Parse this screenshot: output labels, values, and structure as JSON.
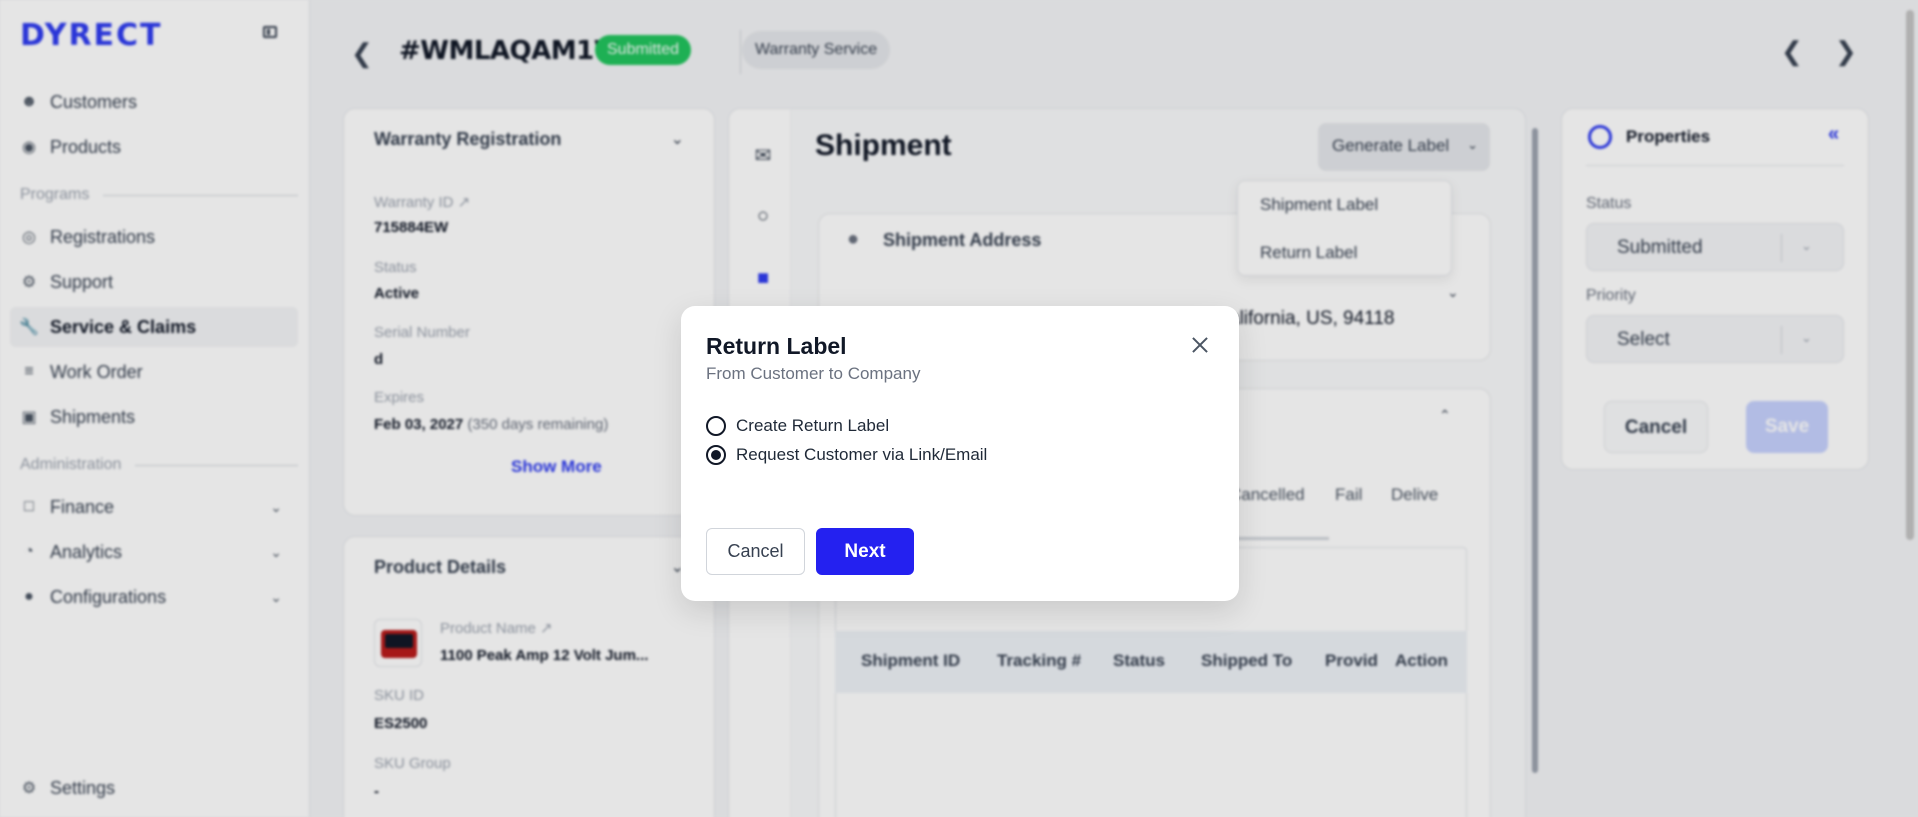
{
  "sidebar": {
    "logo": "DYRECT",
    "items": [
      {
        "label": "Customers",
        "icon": "user-icon"
      },
      {
        "label": "Products",
        "icon": "globe-icon"
      }
    ],
    "programs_section": "Programs",
    "program_items": [
      {
        "label": "Registrations",
        "icon": "circle-check-icon"
      },
      {
        "label": "Support",
        "icon": "support-icon"
      },
      {
        "label": "Service & Claims",
        "icon": "wrench-icon",
        "active": true
      },
      {
        "label": "Work Order",
        "icon": "workorder-icon"
      },
      {
        "label": "Shipments",
        "icon": "truck-icon"
      }
    ],
    "admin_section": "Administration",
    "admin_items": [
      {
        "label": "Finance",
        "icon": "wallet-icon"
      },
      {
        "label": "Analytics",
        "icon": "chart-icon"
      },
      {
        "label": "Configurations",
        "icon": "gear-icon"
      }
    ],
    "settings": "Settings"
  },
  "header": {
    "ticket_id": "#WMLAQAM1W",
    "status_badge": "Submitted",
    "service_badge": "Warranty Service"
  },
  "warranty_card": {
    "title": "Warranty Registration",
    "warranty_id_label": "Warranty ID",
    "warranty_id": "715884EW",
    "status_label": "Status",
    "status": "Active",
    "serial_label": "Serial Number",
    "serial": "d",
    "expires_label": "Expires",
    "expires": "Feb 03, 2027",
    "expires_note": "(350 days remaining)",
    "show_more": "Show More"
  },
  "product_card": {
    "title": "Product Details",
    "name_label": "Product Name",
    "name": "1100 Peak Amp 12 Volt Jum...",
    "sku_label": "SKU ID",
    "sku": "ES2500",
    "sku_group_label": "SKU Group",
    "sku_group": "-"
  },
  "shipment": {
    "title": "Shipment",
    "generate_label": "Generate Label",
    "menu": [
      "Shipment Label",
      "Return Label"
    ],
    "address_title": "Shipment Address",
    "address_line": "alifornia, US, 94118",
    "tabs": [
      "Cancelled",
      "Fail",
      "Delive"
    ],
    "columns": [
      "Shipment ID",
      "Tracking #",
      "Status",
      "Shipped To",
      "Provid",
      "Action"
    ]
  },
  "properties": {
    "title": "Properties",
    "status_label": "Status",
    "status_value": "Submitted",
    "priority_label": "Priority",
    "priority_value": "Select",
    "cancel": "Cancel",
    "save": "Save"
  },
  "modal": {
    "title": "Return Label",
    "subtitle": "From Customer to Company",
    "options": [
      {
        "label": "Create Return Label",
        "checked": false
      },
      {
        "label": "Request Customer via Link/Email",
        "checked": true
      }
    ],
    "cancel": "Cancel",
    "next": "Next"
  },
  "colors": {
    "brand": "#2f3cf0",
    "primary_button": "#2421f0",
    "submitted_badge": "#22c55e"
  }
}
